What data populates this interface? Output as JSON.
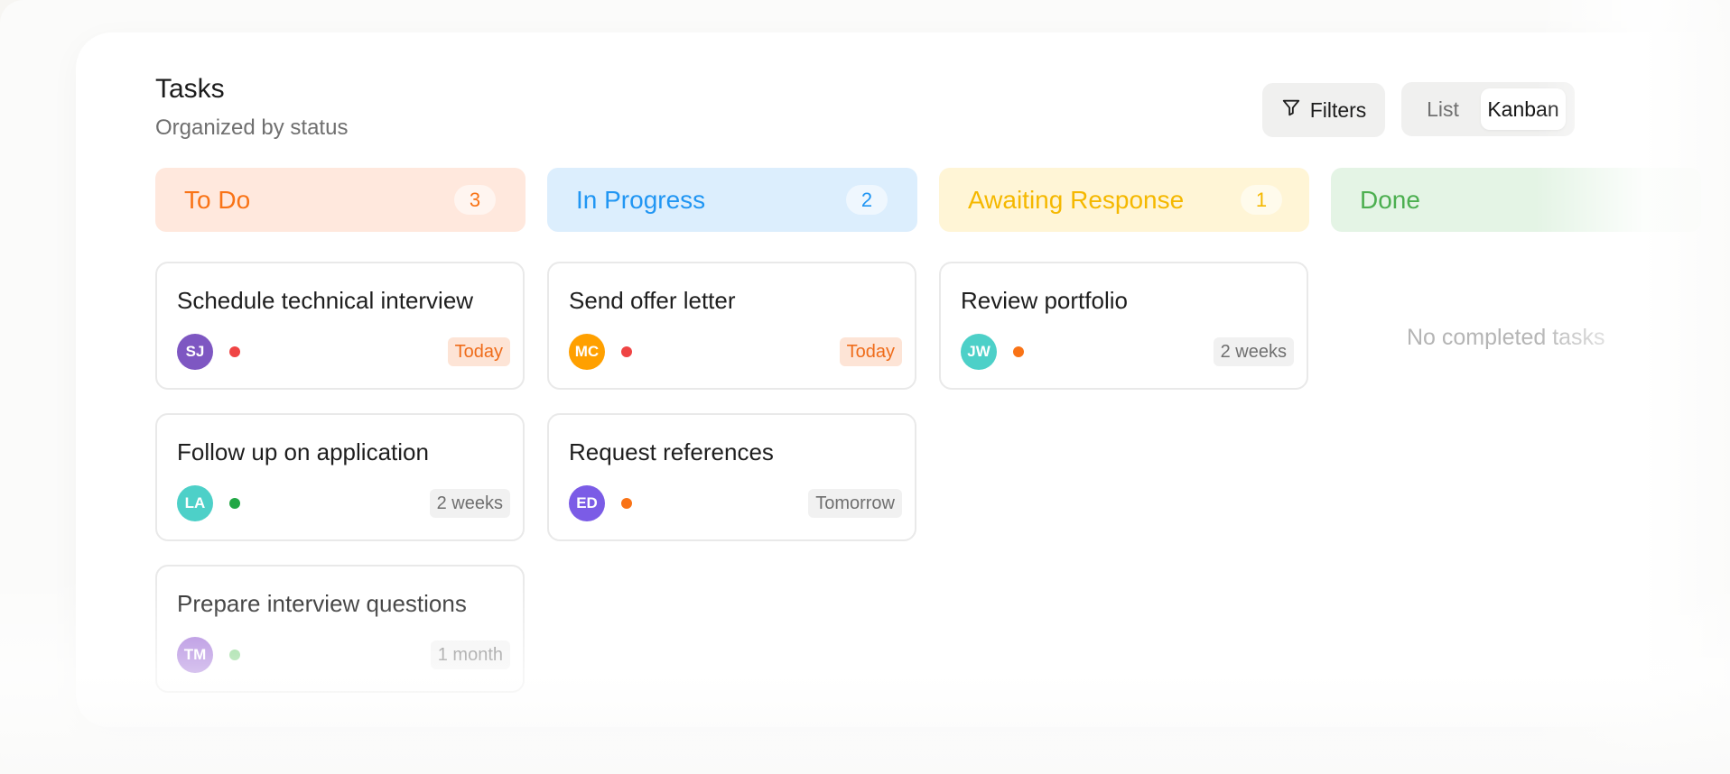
{
  "header": {
    "title": "Tasks",
    "subtitle": "Organized by status"
  },
  "toolbar": {
    "filters_label": "Filters",
    "filters_icon": "filter-icon",
    "view_options": [
      "List",
      "Kanban"
    ],
    "active_view": "Kanban"
  },
  "columns": [
    {
      "title": "To Do",
      "count": "3",
      "color": "#f97316",
      "bg": "#ffe8dd"
    },
    {
      "title": "In Progress",
      "count": "2",
      "color": "#2196f3",
      "bg": "#dceefd"
    },
    {
      "title": "Awaiting Response",
      "count": "1",
      "color": "#f5b800",
      "bg": "#fff5d6"
    },
    {
      "title": "Done",
      "count": "",
      "color": "#4caf50",
      "bg": "#e4f4e5"
    }
  ],
  "cards": {
    "todo": [
      {
        "title": "Schedule technical interview",
        "initials": "SJ",
        "avatar_color": "#7e57c2",
        "priority_color": "#ef4444",
        "due": "Today"
      },
      {
        "title": "Follow up on application",
        "initials": "LA",
        "avatar_color": "#4dd0c8",
        "priority_color": "#22a745",
        "due": "2 weeks"
      },
      {
        "title": "Prepare interview questions",
        "initials": "TM",
        "avatar_color": "#9c6bd6",
        "priority_color": "#7cd17f",
        "due": "1 month"
      }
    ],
    "inprogress": [
      {
        "title": "Send offer letter",
        "initials": "MC",
        "avatar_color": "#ffa000",
        "priority_color": "#ef4444",
        "due": "Today"
      },
      {
        "title": "Request references",
        "initials": "ED",
        "avatar_color": "#7b5ce6",
        "priority_color": "#f97316",
        "due": "Tomorrow"
      }
    ],
    "awaiting": [
      {
        "title": "Review portfolio",
        "initials": "JW",
        "avatar_color": "#4dd0c8",
        "priority_color": "#f97316",
        "due": "2 weeks"
      }
    ]
  },
  "done_empty_text": "No completed tasks"
}
